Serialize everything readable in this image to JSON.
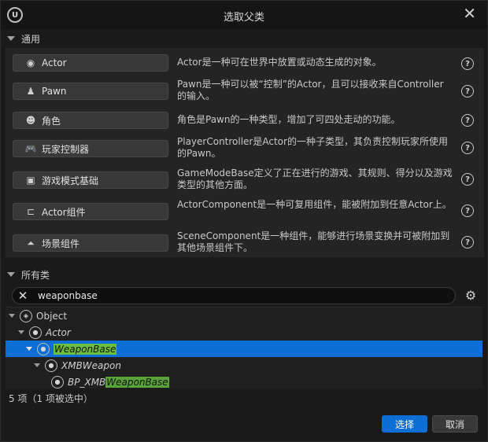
{
  "window": {
    "title": "选取父类"
  },
  "common": {
    "header": "通用",
    "items": [
      {
        "label": "Actor",
        "icon": "actor-icon",
        "desc": "Actor是一种可在世界中放置或动态生成的对象。"
      },
      {
        "label": "Pawn",
        "icon": "pawn-icon",
        "desc": "Pawn是一种可以被“控制”的Actor，且可以接收来自Controller的输入。"
      },
      {
        "label": "角色",
        "icon": "character-icon",
        "desc": "角色是Pawn的一种类型，增加了可四处走动的功能。"
      },
      {
        "label": "玩家控制器",
        "icon": "gamepad-icon",
        "desc": "PlayerController是Actor的一种子类型，其负责控制玩家所使用的Pawn。"
      },
      {
        "label": "游戏模式基础",
        "icon": "gamemode-icon",
        "desc": "GameModeBase定义了正在进行的游戏、其规则、得分以及游戏类型的其他方面。"
      },
      {
        "label": "Actor组件",
        "icon": "component-icon",
        "desc": "ActorComponent是一种可复用组件，能被附加到任意Actor上。"
      },
      {
        "label": "场景组件",
        "icon": "scene-component-icon",
        "desc": "SceneComponent是一种组件，能够进行场景变换并可被附加到其他场景组件下。"
      }
    ]
  },
  "all_classes": {
    "header": "所有类",
    "search_value": "weaponbase",
    "tree": [
      {
        "label": "Object",
        "italic": false
      },
      {
        "label": "Actor",
        "italic": true
      },
      {
        "label": "WeaponBase",
        "italic": true,
        "selected": true
      },
      {
        "label": "XMBWeapon",
        "italic": true
      },
      {
        "label_prefix": "BP_XMB",
        "label_match": "WeaponBase",
        "italic": true
      }
    ],
    "status": "5 项（1 项被选中）"
  },
  "buttons": {
    "select": "选择",
    "cancel": "取消"
  },
  "colors": {
    "accent": "#0d6fd6",
    "highlight": "#5aa33a",
    "background": "#1a1a1a"
  }
}
